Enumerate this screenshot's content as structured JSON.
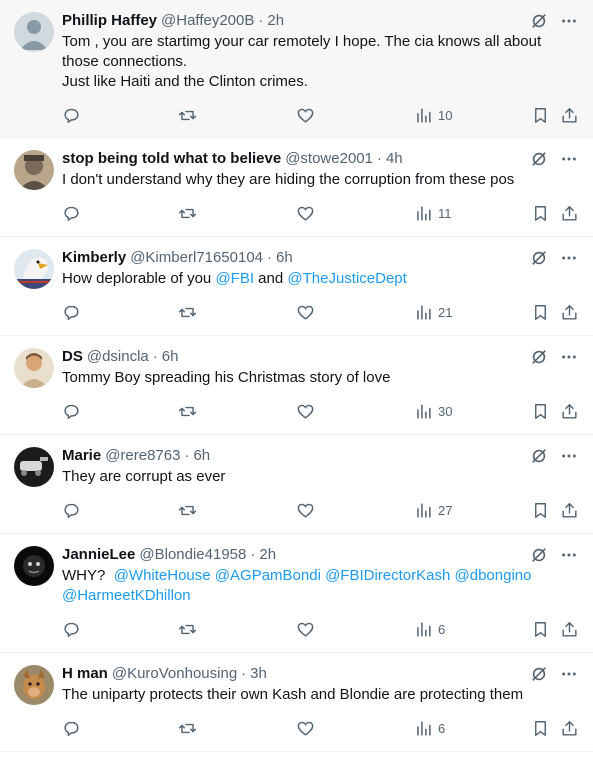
{
  "colors": {
    "link": "#1d9bf0",
    "muted": "#536471",
    "text": "#0f1419"
  },
  "tweets": [
    {
      "name": "Phillip Haffey",
      "handle": "@Haffey200B",
      "time": "2h",
      "text": "Tom , you are startimg your car remotely I hope.  The cia knows all about those connections.\nJust like Haiti and the Clinton crimes.",
      "views": "10"
    },
    {
      "name": "stop being told what to believe",
      "handle": "@stowe2001",
      "time": "4h",
      "text": "I don't understand why they are hiding the corruption from these pos",
      "views": "11"
    },
    {
      "name": "Kimberly",
      "handle": "@Kimberl71650104",
      "time": "6h",
      "text_prefix": "How deplorable of you ",
      "mention1": "@FBI",
      "text_mid": " and ",
      "mention2": "@TheJusticeDept",
      "views": "21"
    },
    {
      "name": "DS",
      "handle": "@dsincla",
      "time": "6h",
      "text": "Tommy Boy spreading his Christmas story of love",
      "views": "30"
    },
    {
      "name": "Marie",
      "handle": "@rere8763",
      "time": "6h",
      "text": "They are corrupt as ever",
      "views": "27"
    },
    {
      "name": "JannieLee",
      "handle": "@Blondie41958",
      "time": "2h",
      "text_prefix": "WHY?  ",
      "mentions": [
        "@WhiteHouse",
        "@AGPamBondi",
        "@FBIDirectorKash",
        "@dbongino",
        "@HarmeetKDhillon"
      ],
      "views": "6"
    },
    {
      "name": "H man",
      "handle": "@KuroVonhousing",
      "time": "3h",
      "text": "The uniparty protects their own Kash and Blondie are protecting them",
      "views": "6"
    }
  ]
}
